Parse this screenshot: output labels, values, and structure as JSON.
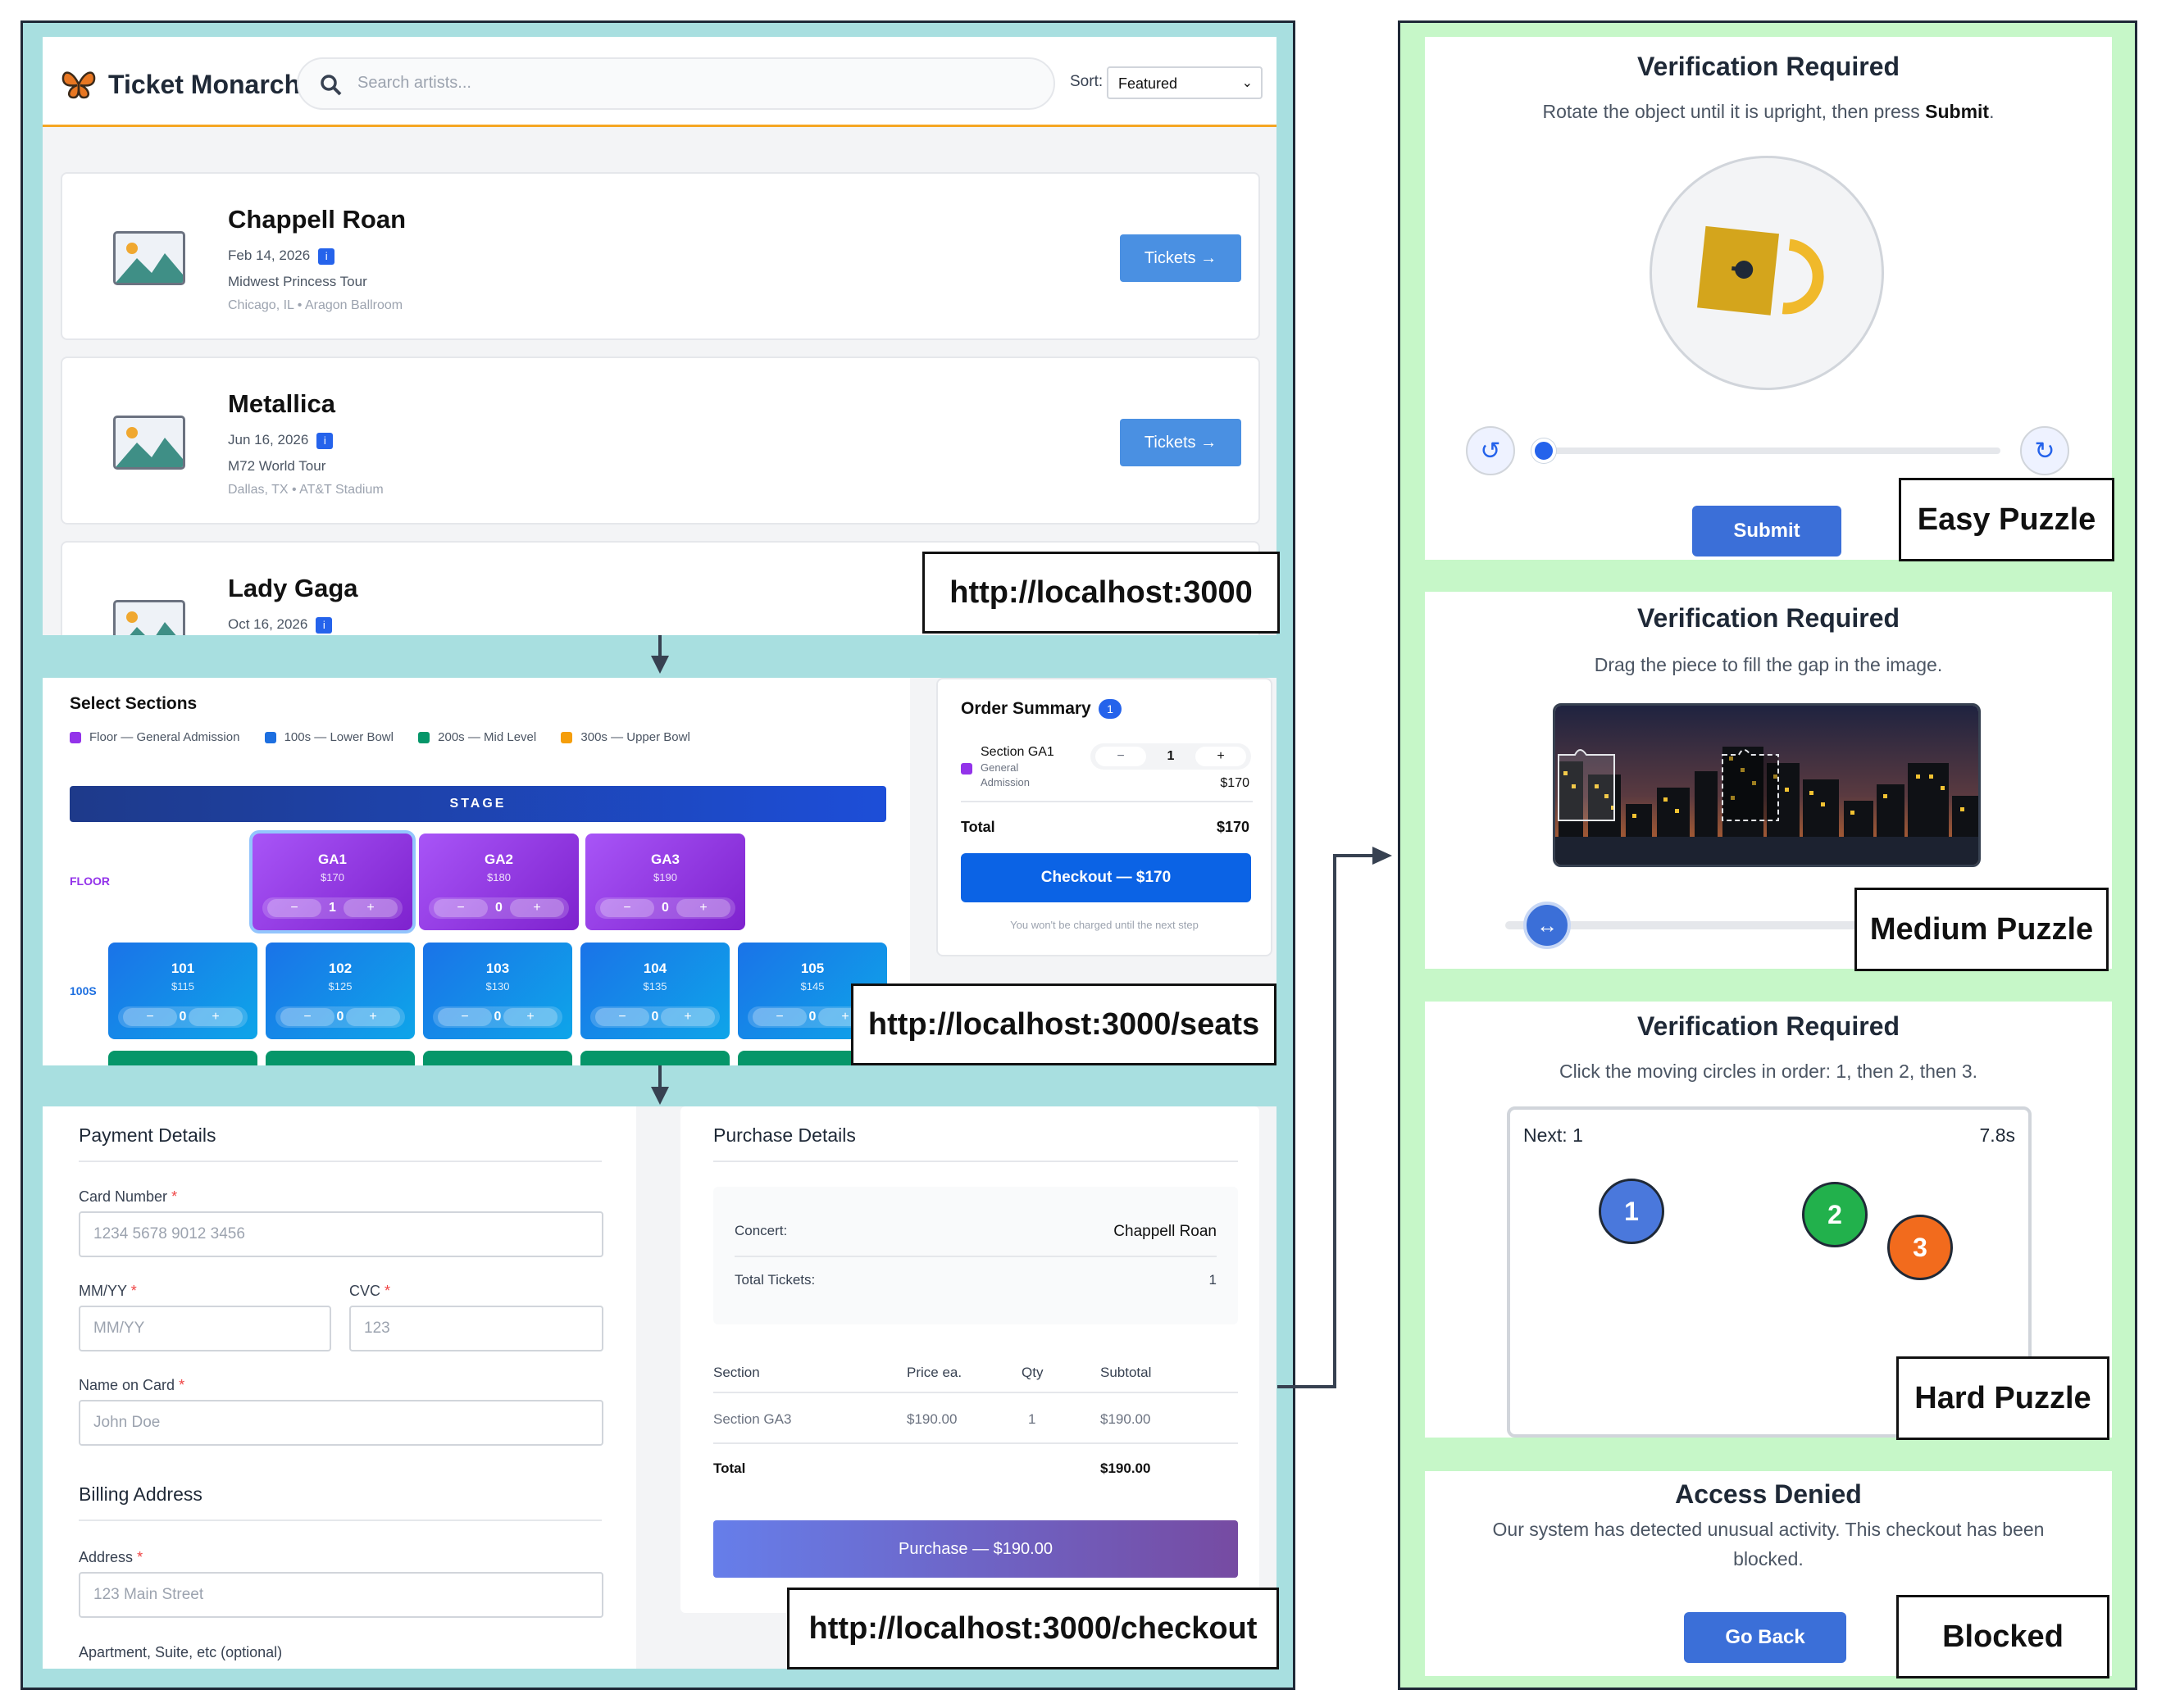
{
  "home": {
    "brand": "Ticket Monarch",
    "search_placeholder": "Search artists...",
    "sort_label": "Sort:",
    "sort_value": "Featured",
    "tickets_label": "Tickets →",
    "events": [
      {
        "artist": "Chappell Roan",
        "date": "Feb 14, 2026",
        "tour": "Midwest Princess Tour",
        "venue": "Chicago, IL • Aragon Ballroom"
      },
      {
        "artist": "Metallica",
        "date": "Jun 16, 2026",
        "tour": "M72 World Tour",
        "venue": "Dallas, TX • AT&T Stadium"
      },
      {
        "artist": "Lady Gaga",
        "date": "Oct 16, 2026",
        "tour": "",
        "venue": ""
      }
    ],
    "url": "http://localhost:3000"
  },
  "seats": {
    "title": "Select Sections",
    "legend": [
      {
        "label": "Floor — General Admission",
        "color": "#9333ea"
      },
      {
        "label": "100s — Lower Bowl",
        "color": "#1d6fe0"
      },
      {
        "label": "200s — Mid Level",
        "color": "#059669"
      },
      {
        "label": "300s — Upper Bowl",
        "color": "#f59e0b"
      }
    ],
    "stage": "STAGE",
    "floor_label": "FLOOR",
    "lower_label": "100S",
    "floor_sections": [
      {
        "name": "GA1",
        "price": "$170",
        "qty": "1"
      },
      {
        "name": "GA2",
        "price": "$180",
        "qty": "0"
      },
      {
        "name": "GA3",
        "price": "$190",
        "qty": "0"
      }
    ],
    "lower_sections": [
      {
        "name": "101",
        "price": "$115",
        "qty": "0"
      },
      {
        "name": "102",
        "price": "$125",
        "qty": "0"
      },
      {
        "name": "103",
        "price": "$130",
        "qty": "0"
      },
      {
        "name": "104",
        "price": "$135",
        "qty": "0"
      },
      {
        "name": "105",
        "price": "$145",
        "qty": "0"
      }
    ],
    "minus": "−",
    "plus": "+",
    "summary": {
      "title": "Order Summary",
      "count": "1",
      "item_name": "Section GA1",
      "item_sub1": "General",
      "item_sub2": "Admission",
      "item_qty": "1",
      "item_price": "$170",
      "total_label": "Total",
      "total_value": "$170",
      "checkout": "Checkout — $170",
      "note": "You won't be charged until the next step"
    },
    "url": "http://localhost:3000/seats"
  },
  "checkout": {
    "payment_title": "Payment Details",
    "card_label": "Card Number",
    "card_placeholder": "1234 5678 9012 3456",
    "exp_label": "MM/YY",
    "exp_placeholder": "MM/YY",
    "cvc_label": "CVC",
    "cvc_placeholder": "123",
    "name_label": "Name on Card",
    "name_placeholder": "John Doe",
    "billing_title": "Billing Address",
    "address_label": "Address",
    "address_placeholder": "123 Main Street",
    "apt_label": "Apartment, Suite, etc (optional)",
    "req_mark": "*",
    "purchase_title": "Purchase Details",
    "concert_label": "Concert:",
    "concert_value": "Chappell Roan",
    "tickets_label": "Total Tickets:",
    "tickets_value": "1",
    "col_section": "Section",
    "col_price": "Price ea.",
    "col_qty": "Qty",
    "col_subtotal": "Subtotal",
    "row_section": "Section GA3",
    "row_price": "$190.00",
    "row_qty": "1",
    "row_subtotal": "$190.00",
    "total_label": "Total",
    "total_value": "$190.00",
    "purchase_button": "Purchase — $190.00",
    "url": "http://localhost:3000/checkout"
  },
  "puzzles": {
    "title": "Verification Required",
    "easy_desc_prefix": "Rotate the object until it is upright, then press ",
    "easy_desc_bold": "Submit",
    "easy_desc_suffix": ".",
    "submit": "Submit",
    "easy_tag": "Easy Puzzle",
    "medium_desc": "Drag the piece to fill the gap in the image.",
    "medium_tag": "Medium Puzzle",
    "hard_desc": "Click the moving circles in order: 1, then 2, then 3.",
    "hard_next": "Next: 1",
    "hard_timer": "7.8s",
    "hard_circles": [
      "1",
      "2",
      "3"
    ],
    "hard_tag": "Hard Puzzle",
    "blocked_title": "Access Denied",
    "blocked_desc_line1": "Our system has detected unusual activity. This checkout has been",
    "blocked_desc_line2": "blocked.",
    "go_back": "Go Back",
    "blocked_tag": "Blocked"
  },
  "icons": {
    "logo": "butterfly-icon",
    "search": "search-icon",
    "rotate_left": "rotate-ccw-icon",
    "rotate_right": "rotate-cw-icon",
    "drag": "horizontal-arrows-icon"
  },
  "colors": {
    "left_frame": "#a8dfe0",
    "right_frame": "#c6f7c8",
    "primary": "#3b6fd8",
    "floor": "#9333ea",
    "lower": "#1d6fe0",
    "mid": "#059669"
  }
}
